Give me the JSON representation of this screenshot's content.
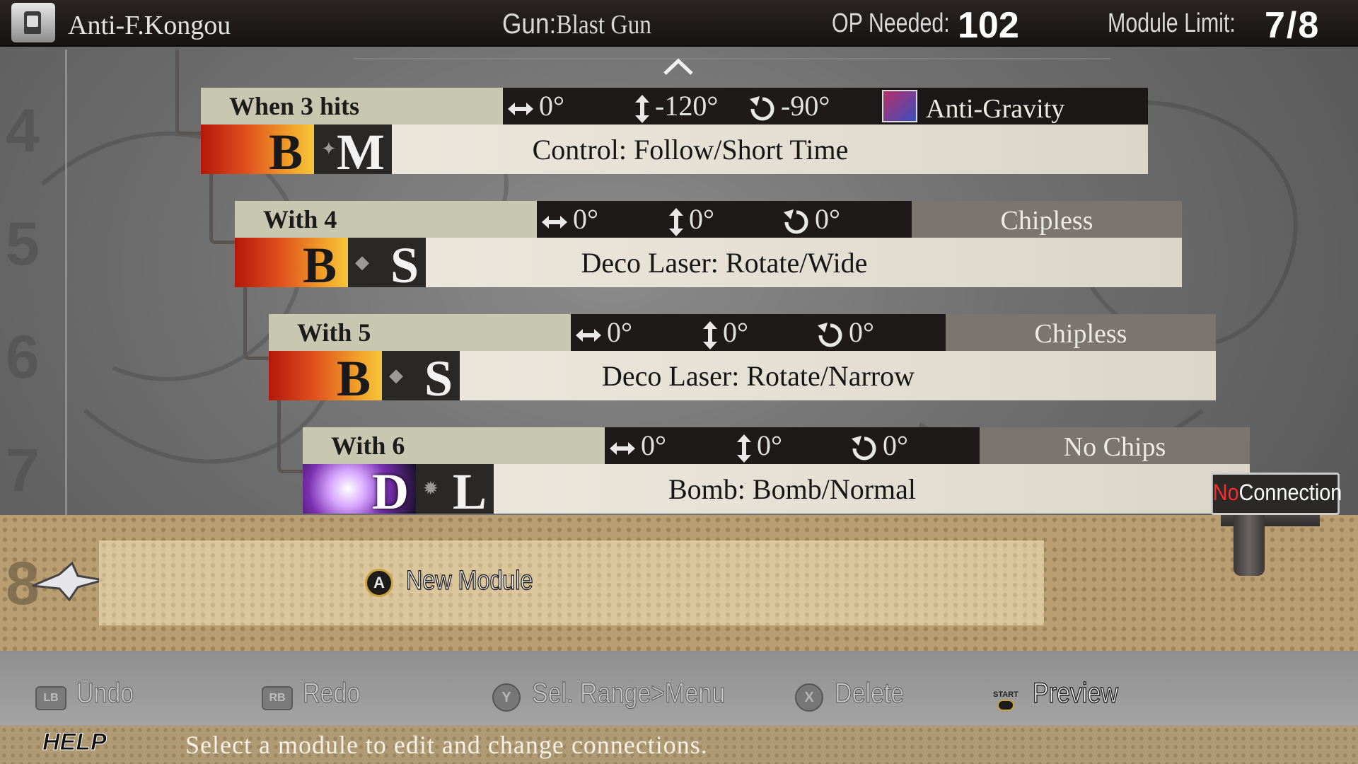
{
  "header": {
    "character": "Anti-F.Kongou",
    "gun_label": "Gun:",
    "gun_value": "Blast Gun",
    "op_label": "OP Needed:",
    "op_value": "102",
    "module_label": "Module  Limit:",
    "module_value": "7/8"
  },
  "row_numbers": [
    "4",
    "5",
    "6",
    "7",
    "8"
  ],
  "modules": [
    {
      "row": "4",
      "trigger": "When 3 hits",
      "h_angle": "0°",
      "v_angle": "-120°",
      "r_angle": "-90°",
      "chip": "Anti-Gravity",
      "chip_icon": "anti-gravity-chip-icon",
      "bullet": "B",
      "type": "M",
      "name": "Control: Follow/Short Time"
    },
    {
      "row": "5",
      "trigger": "With 4",
      "h_angle": "0°",
      "v_angle": "0°",
      "r_angle": "0°",
      "chip": "Chipless",
      "bullet": "B",
      "type": "S",
      "name": "Deco Laser: Rotate/Wide"
    },
    {
      "row": "6",
      "trigger": "With 5",
      "h_angle": "0°",
      "v_angle": "0°",
      "r_angle": "0°",
      "chip": "Chipless",
      "bullet": "B",
      "type": "S",
      "name": "Deco Laser: Rotate/Narrow"
    },
    {
      "row": "7",
      "trigger": "With 6",
      "h_angle": "0°",
      "v_angle": "0°",
      "r_angle": "0°",
      "chip": "No Chips",
      "bullet": "D",
      "type": "L",
      "name": "Bomb: Bomb/Normal"
    }
  ],
  "no_connection": {
    "no": "No",
    "connection": "Connection"
  },
  "new_module": {
    "button": "A",
    "label": "New Module"
  },
  "controls": [
    {
      "button": "LB",
      "label": "Undo"
    },
    {
      "button": "RB",
      "label": "Redo"
    },
    {
      "button": "Y",
      "label": "Sel. Range>Menu"
    },
    {
      "button": "X",
      "label": "Delete"
    },
    {
      "button": "START",
      "label": "Preview"
    }
  ],
  "help": {
    "tag": "HELP",
    "text": "Select a module to edit and change connections."
  },
  "colors": {
    "trigger_bg": "#c8c7b0",
    "bullet_fire": "#e0501e",
    "chipless_bg": "#7a766f",
    "no_connection_red": "#ff2a2a"
  }
}
